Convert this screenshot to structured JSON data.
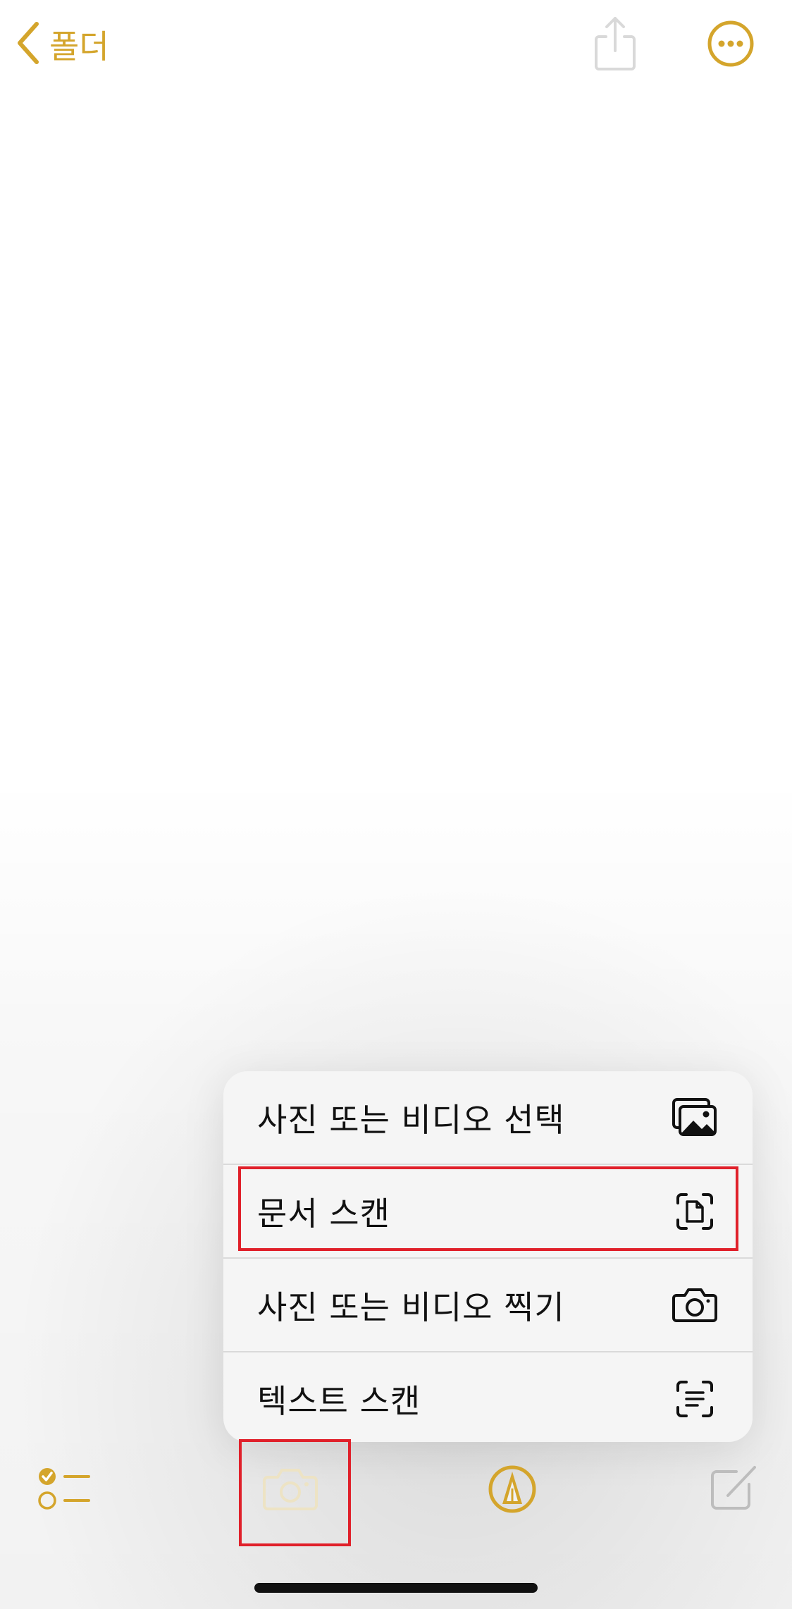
{
  "app": "Notes",
  "colors": {
    "accent": "#D4A52C",
    "highlight": "#E0202A",
    "menu_bg": "#F5F5F5",
    "text": "#111111"
  },
  "nav": {
    "back_label": "폴더",
    "back_icon": "chevron-left-icon",
    "share_icon": "share-icon",
    "more_icon": "ellipsis-circle-icon"
  },
  "attachment_menu": {
    "items": [
      {
        "label": "사진 또는 비디오 선택",
        "icon": "photo-library-icon"
      },
      {
        "label": "문서 스캔",
        "icon": "document-scan-icon",
        "highlighted": true
      },
      {
        "label": "사진 또는 비디오 찍기",
        "icon": "camera-icon"
      },
      {
        "label": "텍스트 스캔",
        "icon": "text-scan-icon"
      }
    ]
  },
  "toolbar": {
    "items": [
      {
        "name": "checklist",
        "icon": "checklist-icon"
      },
      {
        "name": "camera",
        "icon": "camera-icon",
        "active": true,
        "highlighted": true
      },
      {
        "name": "markup",
        "icon": "markup-pen-icon"
      },
      {
        "name": "compose",
        "icon": "compose-icon"
      }
    ]
  }
}
